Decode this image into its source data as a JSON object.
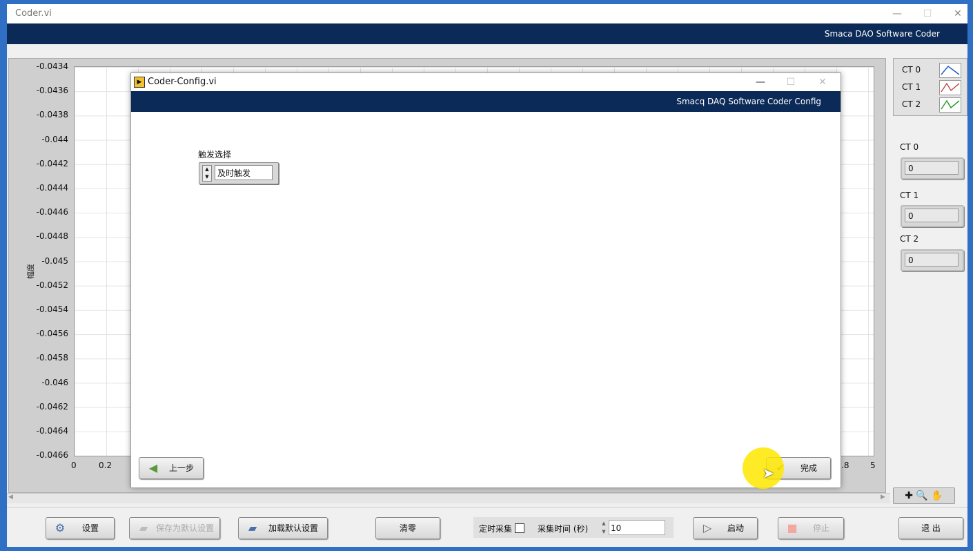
{
  "main": {
    "title": "Coder.vi",
    "banner": "Smaca DAO Software Coder",
    "window_controls": {
      "minimize": "—",
      "maximize": "☐",
      "close": "✕"
    }
  },
  "graph": {
    "y_axis_label": "幅度",
    "y_ticks": [
      "-0.0434",
      "-0.0436",
      "-0.0438",
      "-0.044",
      "-0.0442",
      "-0.0444",
      "-0.0446",
      "-0.0448",
      "-0.045",
      "-0.0452",
      "-0.0454",
      "-0.0456",
      "-0.0458",
      "-0.046",
      "-0.0462",
      "-0.0464",
      "-0.0466"
    ],
    "x_ticks_left": [
      "0",
      "0.2"
    ],
    "x_ticks_right": [
      ".8",
      "5"
    ]
  },
  "legend": {
    "items": [
      {
        "label": "CT 0",
        "color": "#1e5fbf"
      },
      {
        "label": "CT 1",
        "color": "#b33030"
      },
      {
        "label": "CT 2",
        "color": "#2a9a2a"
      }
    ]
  },
  "indicators": [
    {
      "label": "CT 0",
      "value": "0"
    },
    {
      "label": "CT 1",
      "value": "0"
    },
    {
      "label": "CT 2",
      "value": "0"
    }
  ],
  "bottom": {
    "settings": "设置",
    "save_default": "保存为默认设置",
    "load_default": "加载默认设置",
    "clear": "清零",
    "timed_acq": "定时采集",
    "acq_time_label": "采集时间 (秒)",
    "acq_time_value": "10",
    "start": "启动",
    "stop": "停止",
    "exit": "退 出"
  },
  "dialog": {
    "title": "Coder-Config.vi",
    "banner": "Smacq DAQ Software Coder Config",
    "trigger_label": "触发选择",
    "trigger_value": "及时触发",
    "prev": "上一步",
    "finish": "完成",
    "window_controls": {
      "minimize": "—",
      "maximize": "☐",
      "close": "✕"
    }
  }
}
